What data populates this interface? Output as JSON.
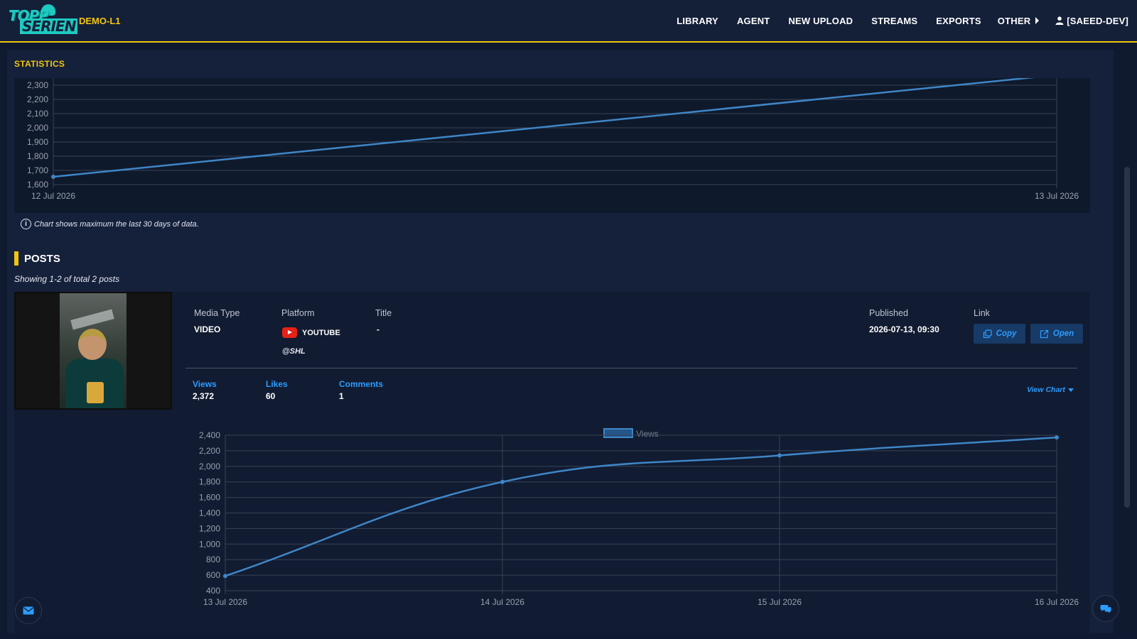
{
  "header": {
    "logo_top": "TOPP",
    "logo_bottom": "SERIEN",
    "brand": "DEMO-L1",
    "nav": [
      "LIBRARY",
      "AGENT",
      "NEW UPLOAD",
      "STREAMS",
      "EXPORTS",
      "OTHER"
    ],
    "user": "[SAEED-DEV]",
    "accent": "#f2c40f"
  },
  "statistics": {
    "title": "STATISTICS",
    "note": "Chart shows maximum the last 30 days of data."
  },
  "posts": {
    "title": "POSTS",
    "count": "Showing 1-2 of total 2 posts",
    "items": [
      {
        "media_type_label": "Media Type",
        "media_type": "VIDEO",
        "platform_label": "Platform",
        "platform": "YOUTUBE",
        "handle": "@SHL",
        "title_label": "Title",
        "title": "-",
        "published_label": "Published",
        "published": "2026-07-13, 09:30",
        "link_label": "Link",
        "copy_label": "Copy",
        "open_label": "Open",
        "views_label": "Views",
        "views": "2,372",
        "likes_label": "Likes",
        "likes": "60",
        "comments_label": "Comments",
        "comments": "1",
        "view_chart_label": "View Chart"
      }
    ]
  },
  "chart_data": [
    {
      "type": "line",
      "x": [
        "12 Jul 2026",
        "13 Jul 2026"
      ],
      "series": [
        {
          "values": [
            1655,
            2372
          ]
        }
      ],
      "yticks": [
        "1,600",
        "1,700",
        "1,800",
        "1,900",
        "2,000",
        "2,100",
        "2,200",
        "2,300"
      ],
      "ylim": [
        1600,
        2300
      ],
      "grid": true,
      "color": "#3f86c6"
    },
    {
      "type": "line",
      "x": [
        "13 Jul 2026",
        "14 Jul 2026",
        "15 Jul 2026",
        "16 Jul 2026"
      ],
      "series": [
        {
          "name": "Views",
          "values": [
            590,
            1800,
            2140,
            2372
          ]
        }
      ],
      "yticks": [
        "400",
        "600",
        "800",
        "1,000",
        "1,200",
        "1,400",
        "1,600",
        "1,800",
        "2,000",
        "2,200",
        "2,400"
      ],
      "ylim": [
        400,
        2400
      ],
      "legend": "top-center",
      "grid": true,
      "color": "#3f86c6"
    }
  ]
}
